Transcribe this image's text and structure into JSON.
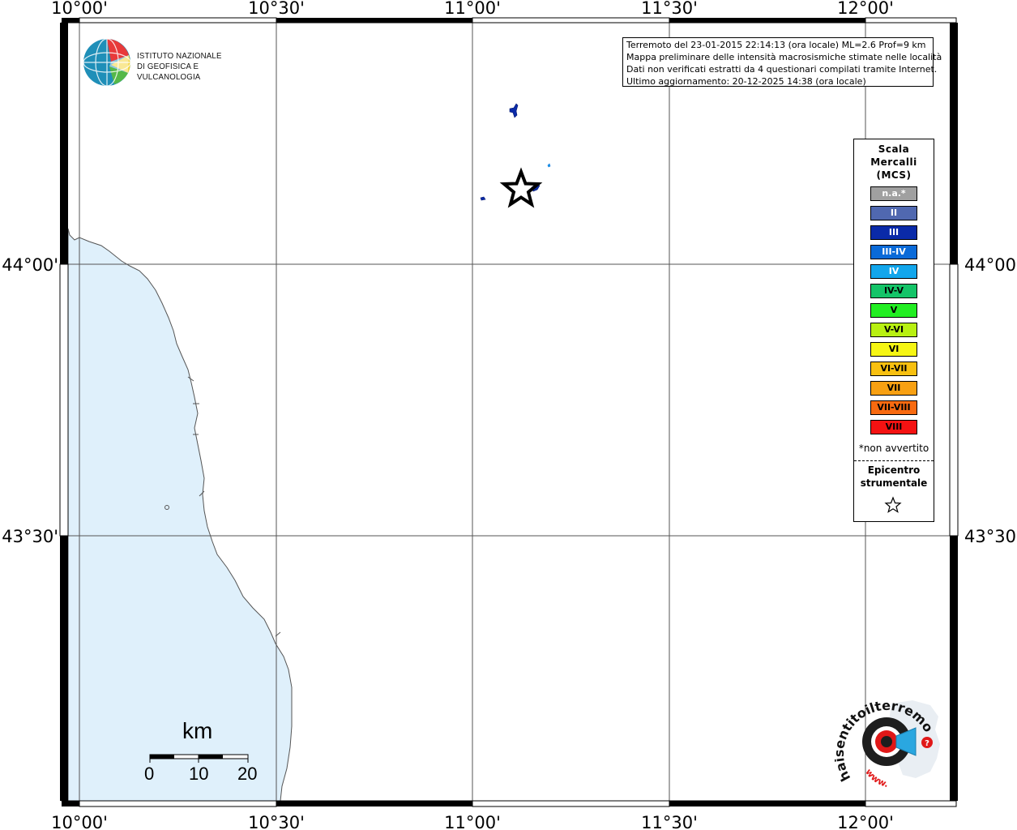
{
  "map": {
    "lon_ticks_top": [
      "10°00'",
      "10°30'",
      "11°00'",
      "11°30'",
      "12°00'"
    ],
    "lon_ticks_bottom": [
      "10°00'",
      "10°30'",
      "11°00'",
      "11°30'",
      "12°00'"
    ],
    "lat_ticks_left": [
      "44°00'",
      "43°30'"
    ],
    "lat_ticks_right": [
      "44°00'",
      "43°30'"
    ],
    "sea_color": "#dff0fb",
    "grid_lines": true
  },
  "institute": {
    "line1": "ISTITUTO NAZIONALE",
    "line2": "DI GEOFISICA E VULCANOLOGIA"
  },
  "info": {
    "line1": "Terremoto del 23-01-2015 22:14:13 (ora locale) ML=2.6 Prof=9 km",
    "line2": "Mappa preliminare delle intensità macrosismiche stimate nelle località",
    "line3": "Dati non verificati estratti da 4 questionari compilati tramite Internet.",
    "line4": "Ultimo aggiornamento: 20-12-2025 14:38 (ora locale)"
  },
  "legend": {
    "title_line1": "Scala",
    "title_line2": "Mercalli",
    "title_line3": "(MCS)",
    "items": [
      {
        "label": "n.a.*",
        "color": "#a0a0a0",
        "text_color": "#ffffff"
      },
      {
        "label": "II",
        "color": "#5068b0",
        "text_color": "#ffffff"
      },
      {
        "label": "III",
        "color": "#0a2aa8",
        "text_color": "#ffffff"
      },
      {
        "label": "III-IV",
        "color": "#0a6ad8",
        "text_color": "#ffffff"
      },
      {
        "label": "IV",
        "color": "#12a6ec",
        "text_color": "#ffffff"
      },
      {
        "label": "IV-V",
        "color": "#14c468",
        "text_color": "#000000"
      },
      {
        "label": "V",
        "color": "#22ee22",
        "text_color": "#000000"
      },
      {
        "label": "V-VI",
        "color": "#b8f012",
        "text_color": "#000000"
      },
      {
        "label": "VI",
        "color": "#f6f614",
        "text_color": "#000000"
      },
      {
        "label": "VI-VII",
        "color": "#f8c010",
        "text_color": "#000000"
      },
      {
        "label": "VII",
        "color": "#f8a012",
        "text_color": "#000000"
      },
      {
        "label": "VII-VIII",
        "color": "#f86a10",
        "text_color": "#000000"
      },
      {
        "label": "VIII",
        "color": "#f41212",
        "text_color": "#000000"
      }
    ],
    "note": "*non avvertito",
    "epicenter_line1": "Epicentro",
    "epicenter_line2": "strumentale"
  },
  "scale_bar": {
    "unit": "km",
    "labels": [
      "0",
      "10",
      "20"
    ]
  },
  "brand": {
    "text": "haisentitoilterremoto.it",
    "prefix": "www."
  },
  "markers": [
    {
      "name": "epicenter",
      "lon": 11.12,
      "lat": 44.15
    },
    {
      "name": "report-1",
      "lon": 11.1,
      "lat": 44.28,
      "intensity": "III"
    },
    {
      "name": "report-2",
      "lon": 11.02,
      "lat": 44.12,
      "intensity": "III"
    },
    {
      "name": "report-3",
      "lon": 11.16,
      "lat": 44.15,
      "intensity": "III"
    },
    {
      "name": "report-4",
      "lon": 11.19,
      "lat": 44.18,
      "intensity": "IV"
    }
  ]
}
